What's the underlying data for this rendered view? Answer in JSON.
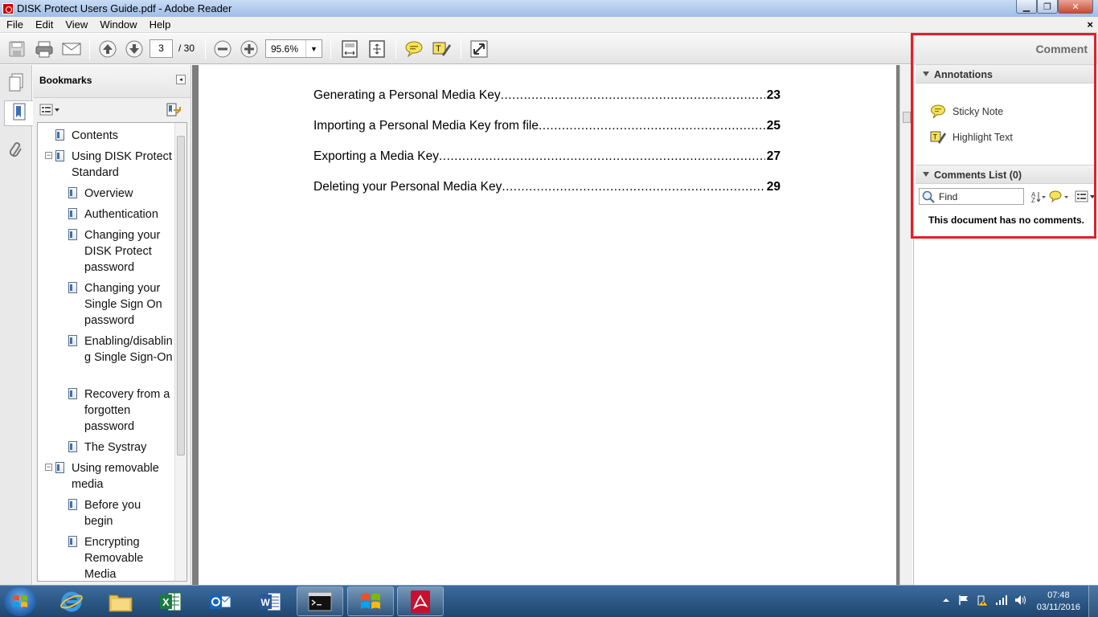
{
  "window": {
    "title": "DISK Protect Users Guide.pdf - Adobe Reader",
    "minimize": "▁",
    "maximize": "❐",
    "close": "✕"
  },
  "menu": {
    "items": [
      "File",
      "Edit",
      "View",
      "Window",
      "Help"
    ],
    "doc_close": "×"
  },
  "toolbar": {
    "page_current": "3",
    "page_total": "/ 30",
    "zoom": "95.6%",
    "zoom_dropdown": "▼"
  },
  "bookmarks": {
    "title": "Bookmarks",
    "collapse_glyph": "◂",
    "items": [
      {
        "label": "Contents"
      },
      {
        "label": "Using DISK Protect Standard",
        "expander": "−"
      },
      {
        "label": "Overview"
      },
      {
        "label": "Authentication"
      },
      {
        "label": "Changing your DISK Protect password"
      },
      {
        "label": "Changing your Single Sign On password"
      },
      {
        "label": "Enabling/disabling Single Sign-On"
      },
      {
        "label": "Recovery from a forgotten password"
      },
      {
        "label": "The Systray"
      },
      {
        "label": "Using removable media",
        "expander": "−"
      },
      {
        "label": "Before you begin"
      },
      {
        "label": "Encrypting Removable Media"
      }
    ]
  },
  "document": {
    "toc": [
      {
        "text": "Generating a Personal Media Key",
        "page": "23"
      },
      {
        "text": "Importing a Personal Media Key from file",
        "page": "25"
      },
      {
        "text": "Exporting a Media Key",
        "page": "27"
      },
      {
        "text": "Deleting your Personal Media Key",
        "page": "29"
      }
    ]
  },
  "comment_pane": {
    "title": "Comment",
    "annotations_header": "Annotations",
    "sticky_note": "Sticky Note",
    "highlight_text": "Highlight Text",
    "comments_list_header": "Comments List (0)",
    "find_placeholder": "Find",
    "no_comments": "This document has no comments."
  },
  "taskbar": {
    "time": "07:48",
    "date": "03/11/2016"
  },
  "colors": {
    "highlight_outline": "#e1202a",
    "acrobat_red": "#c8102e"
  }
}
